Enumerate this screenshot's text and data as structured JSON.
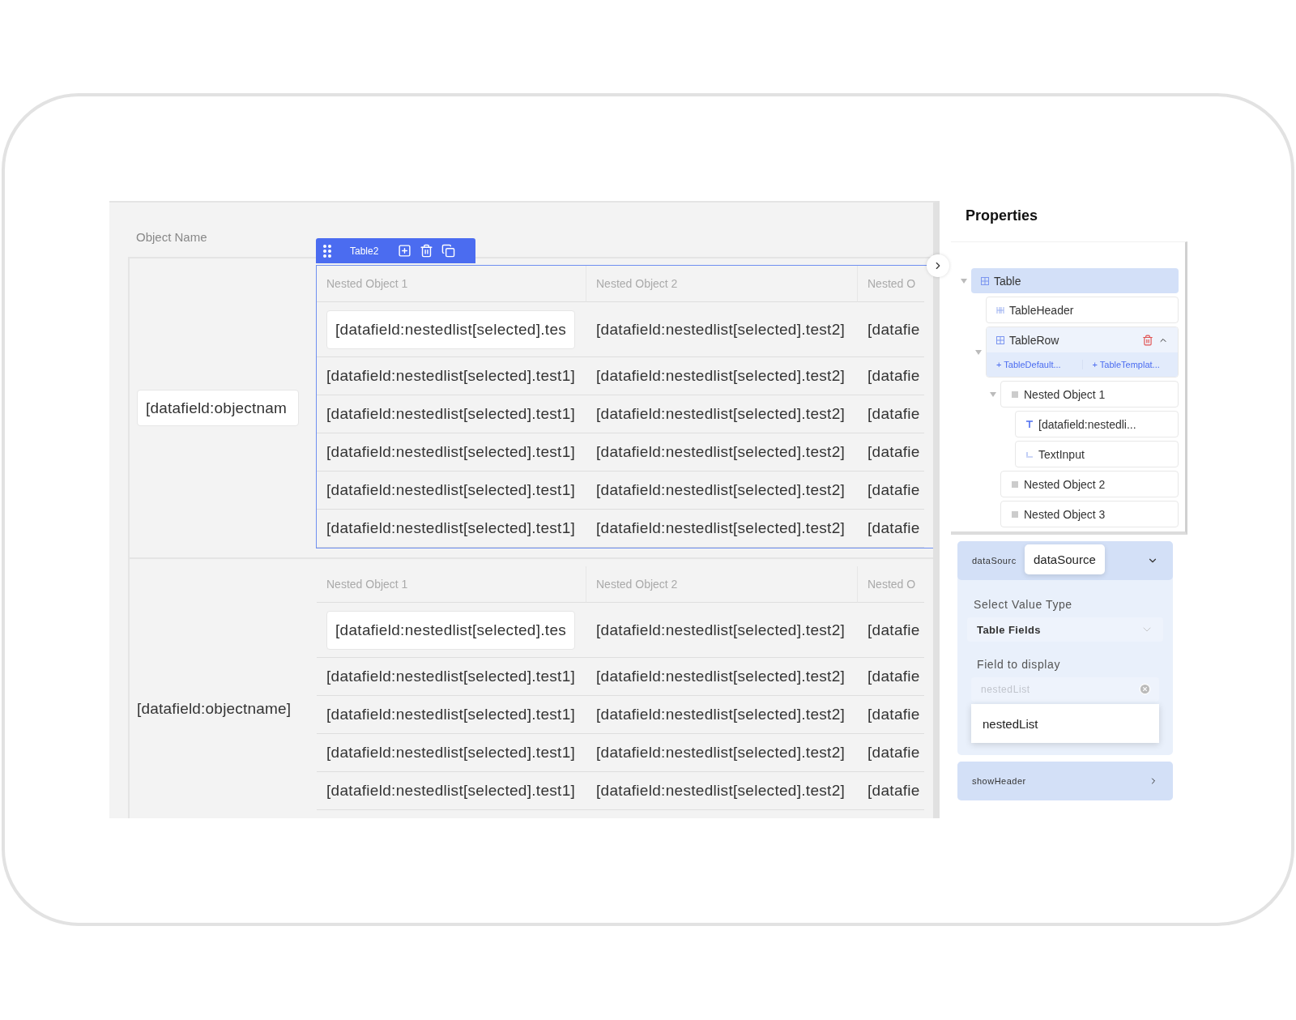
{
  "canvas": {
    "header": "Object Name",
    "toolbar": {
      "label": "Table2"
    },
    "rows": [
      {
        "name": {
          "kind": "input",
          "text": "[datafield:objectnam"
        },
        "table": {
          "selected": true,
          "columns": [
            "Nested Object 1",
            "Nested Object 2",
            "Nested O"
          ],
          "rows": [
            {
              "kind": "input",
              "cells": [
                "[datafield:nestedlist[selected].tes",
                "[datafield:nestedlist[selected].test2]",
                "[datafie"
              ]
            },
            {
              "kind": "text",
              "cells": [
                "[datafield:nestedlist[selected].test1]",
                "[datafield:nestedlist[selected].test2]",
                "[datafie"
              ]
            },
            {
              "kind": "text",
              "cells": [
                "[datafield:nestedlist[selected].test1]",
                "[datafield:nestedlist[selected].test2]",
                "[datafie"
              ]
            },
            {
              "kind": "text",
              "cells": [
                "[datafield:nestedlist[selected].test1]",
                "[datafield:nestedlist[selected].test2]",
                "[datafie"
              ]
            },
            {
              "kind": "text",
              "cells": [
                "[datafield:nestedlist[selected].test1]",
                "[datafield:nestedlist[selected].test2]",
                "[datafie"
              ]
            },
            {
              "kind": "text",
              "cells": [
                "[datafield:nestedlist[selected].test1]",
                "[datafield:nestedlist[selected].test2]",
                "[datafie"
              ]
            }
          ]
        }
      },
      {
        "name": {
          "kind": "text",
          "text": "[datafield:objectname]"
        },
        "table": {
          "selected": false,
          "columns": [
            "Nested Object 1",
            "Nested Object 2",
            "Nested O"
          ],
          "rows": [
            {
              "kind": "input",
              "cells": [
                "[datafield:nestedlist[selected].tes",
                "[datafield:nestedlist[selected].test2]",
                "[datafie"
              ]
            },
            {
              "kind": "text",
              "cells": [
                "[datafield:nestedlist[selected].test1]",
                "[datafield:nestedlist[selected].test2]",
                "[datafie"
              ]
            },
            {
              "kind": "text",
              "cells": [
                "[datafield:nestedlist[selected].test1]",
                "[datafield:nestedlist[selected].test2]",
                "[datafie"
              ]
            },
            {
              "kind": "text",
              "cells": [
                "[datafield:nestedlist[selected].test1]",
                "[datafield:nestedlist[selected].test2]",
                "[datafie"
              ]
            },
            {
              "kind": "text",
              "cells": [
                "[datafield:nestedlist[selected].test1]",
                "[datafield:nestedlist[selected].test2]",
                "[datafie"
              ]
            }
          ]
        }
      }
    ]
  },
  "properties": {
    "title": "Properties",
    "tree": [
      {
        "label": "Table",
        "kind": "table",
        "selected": true,
        "expanded": true,
        "children": [
          {
            "label": "TableHeader",
            "kind": "header",
            "selected": false
          },
          {
            "label": "TableRow",
            "kind": "table",
            "selected": false,
            "expanded": true,
            "actions": [
              "+ TableDefault...",
              "+ TableTemplat..."
            ],
            "children": [
              {
                "label": "Nested Object 1",
                "kind": "object",
                "selected": false,
                "expanded": true,
                "children": [
                  {
                    "label": "[datafield:nestedli...",
                    "kind": "text",
                    "selected": false
                  },
                  {
                    "label": "TextInput",
                    "kind": "input",
                    "selected": false
                  }
                ]
              },
              {
                "label": "Nested Object 2",
                "kind": "object",
                "selected": false
              },
              {
                "label": "Nested Object 3",
                "kind": "object",
                "selected": false
              }
            ]
          }
        ]
      }
    ],
    "sections": [
      {
        "title": "dataSourc",
        "tooltip": "dataSource",
        "expanded": true,
        "select_label": "Select Value Type",
        "select_value": "Table Fields",
        "field_label": "Field to display",
        "field_placeholder": "nestedList",
        "options": [
          "nestedList"
        ]
      },
      {
        "title": "showHeader",
        "expanded": false
      }
    ]
  }
}
